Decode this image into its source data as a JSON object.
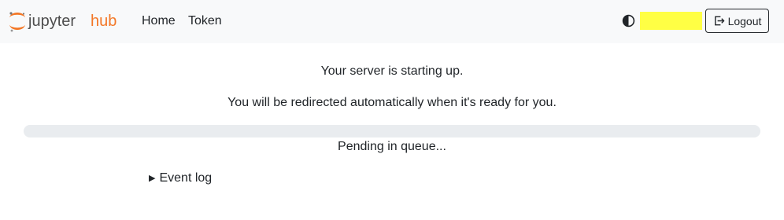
{
  "navbar": {
    "logo": {
      "text_left": "jupyter",
      "text_right": "hub"
    },
    "links": [
      {
        "label": "Home"
      },
      {
        "label": "Token"
      }
    ],
    "theme_toggle_icon": "half-circle-contrast-icon",
    "username": "",
    "logout": {
      "label": "Logout",
      "icon": "logout-icon"
    }
  },
  "main": {
    "message_1": "Your server is starting up.",
    "message_2": "You will be redirected automatically when it's ready for you.",
    "progress_percent": 0,
    "progress_message": "Pending in queue...",
    "event_log_label": "Event log"
  },
  "colors": {
    "accent": "#f37726",
    "navbar_bg": "#f8f9fa",
    "username_highlight": "#ffff44",
    "progress_track": "#e9ecef"
  }
}
